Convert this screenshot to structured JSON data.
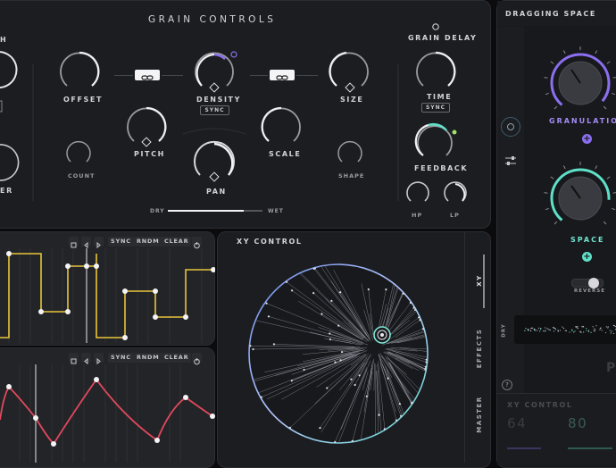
{
  "grain_controls": {
    "title": "GRAIN CONTROLS",
    "left_partial_top": "H",
    "left_partial_bottom": "ER",
    "offset": "OFFSET",
    "density": "DENSITY",
    "density_sync": "SYNC",
    "size": "SIZE",
    "pitch": "PITCH",
    "scale": "SCALE",
    "count": "COUNT",
    "pan": "PAN",
    "shape": "SHAPE",
    "dry": "DRY",
    "wet": "WET",
    "drywet_level": 0.8
  },
  "grain_delay": {
    "title": "GRAIN DELAY",
    "time": "TIME",
    "time_sync": "SYNC",
    "feedback": "FEEDBACK",
    "hp": "HP",
    "lp": "LP"
  },
  "sequencer_toolbar": {
    "sync": "SYNC",
    "rndm": "RNDM",
    "clear": "CLEAR"
  },
  "xy_control": {
    "title": "XY CONTROL",
    "tabs": [
      "XY",
      "EFFECTS",
      "MASTER"
    ]
  },
  "dragging_space": {
    "title": "DRAGGING SPACE",
    "granulation": "GRANULATIO",
    "space": "SPACE",
    "reverse": "REVERSE",
    "dry": "DRY",
    "partial_p": "P",
    "xy_label": "XY CONTROL",
    "xy_x": "64",
    "xy_y": "80"
  },
  "colors": {
    "yellow": "#e8c53a",
    "pink": "#e0495c",
    "purple": "#8b6ff0",
    "teal": "#5fe0c8",
    "panel": "#1e1f22"
  }
}
